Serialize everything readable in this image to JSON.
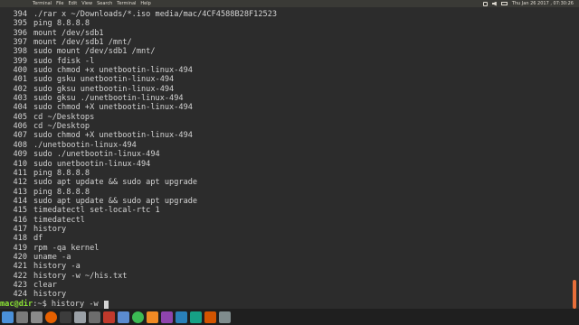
{
  "menubar": {
    "items": [
      "Terminal",
      "File",
      "Edit",
      "View",
      "Search",
      "Terminal",
      "Help"
    ],
    "clock": "Thu Jan 26 2017 , 07:30:26"
  },
  "history": [
    {
      "num": "394",
      "cmd": "./rar x ~/Downloads/*.iso media/mac/4CF4588B28F12523"
    },
    {
      "num": "395",
      "cmd": "ping 8.8.8.8"
    },
    {
      "num": "396",
      "cmd": "mount /dev/sdb1"
    },
    {
      "num": "397",
      "cmd": "mount /dev/sdb1 /mnt/"
    },
    {
      "num": "398",
      "cmd": "sudo mount /dev/sdb1 /mnt/"
    },
    {
      "num": "399",
      "cmd": "sudo fdisk -l"
    },
    {
      "num": "400",
      "cmd": "sudo chmod +x unetbootin-linux-494"
    },
    {
      "num": "401",
      "cmd": "sudo gsku unetbootin-linux-494"
    },
    {
      "num": "402",
      "cmd": "sudo gksu unetbootin-linux-494"
    },
    {
      "num": "403",
      "cmd": "sudo gksu ./unetbootin-linux-494"
    },
    {
      "num": "404",
      "cmd": "sudo chmod +X unetbootin-linux-494"
    },
    {
      "num": "405",
      "cmd": "cd ~/Desktops"
    },
    {
      "num": "406",
      "cmd": "cd ~/Desktop"
    },
    {
      "num": "407",
      "cmd": "sudo chmod +X unetbootin-linux-494"
    },
    {
      "num": "408",
      "cmd": "./unetbootin-linux-494"
    },
    {
      "num": "409",
      "cmd": "sudo ./unetbootin-linux-494"
    },
    {
      "num": "410",
      "cmd": "sudo unetbootin-linux-494"
    },
    {
      "num": "411",
      "cmd": "ping 8.8.8.8"
    },
    {
      "num": "412",
      "cmd": "sudo apt update && sudo apt upgrade"
    },
    {
      "num": "413",
      "cmd": "ping 8.8.8.8"
    },
    {
      "num": "414",
      "cmd": "sudo apt update && sudo apt upgrade"
    },
    {
      "num": "415",
      "cmd": "timedatectl set-local-rtc 1"
    },
    {
      "num": "416",
      "cmd": "timedatectl"
    },
    {
      "num": "417",
      "cmd": "history"
    },
    {
      "num": "418",
      "cmd": "df"
    },
    {
      "num": "419",
      "cmd": "rpm -qa kernel"
    },
    {
      "num": "420",
      "cmd": "uname -a"
    },
    {
      "num": "421",
      "cmd": "history -a"
    },
    {
      "num": "422",
      "cmd": "history -w ~/his.txt"
    },
    {
      "num": "423",
      "cmd": "clear"
    },
    {
      "num": "424",
      "cmd": "history"
    }
  ],
  "prompt": {
    "user": "mac@dir",
    "suffix": ":~$ ",
    "input": "history -w "
  },
  "colors": {
    "background": "#2c2c2c",
    "text": "#d4d4d4",
    "prompt_user": "#8ae234",
    "scrollbar_thumb": "#e86e3a",
    "taskbar": "#1f1f1f"
  },
  "taskbar": {
    "icons": [
      {
        "name": "menu-icon",
        "color": "#4a90d9"
      },
      {
        "name": "show-desktop-icon",
        "color": "#7a7a7a"
      },
      {
        "name": "files-icon",
        "color": "#8a8a8a"
      },
      {
        "name": "firefox-icon",
        "color": "#e66000"
      },
      {
        "name": "terminal-icon",
        "color": "#3c3c3c"
      },
      {
        "name": "text-editor-icon",
        "color": "#9aa0a6"
      },
      {
        "name": "settings-icon",
        "color": "#6d6d6d"
      },
      {
        "name": "software-icon",
        "color": "#c0392b"
      },
      {
        "name": "image-viewer-icon",
        "color": "#5b8bd0"
      },
      {
        "name": "chrome-icon",
        "color": "#3cba54"
      },
      {
        "name": "vlc-icon",
        "color": "#f08a24"
      },
      {
        "name": "app-icon-1",
        "color": "#8e44ad"
      },
      {
        "name": "app-icon-2",
        "color": "#2980b9"
      },
      {
        "name": "app-icon-3",
        "color": "#16a085"
      },
      {
        "name": "app-icon-4",
        "color": "#d35400"
      },
      {
        "name": "app-icon-5",
        "color": "#7f8c8d"
      }
    ]
  }
}
